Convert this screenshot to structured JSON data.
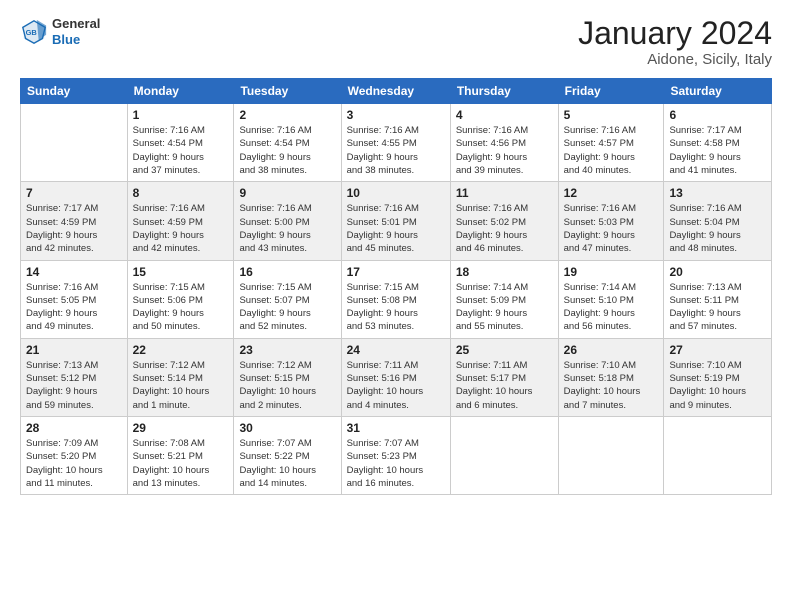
{
  "logo": {
    "general": "General",
    "blue": "Blue"
  },
  "title": "January 2024",
  "subtitle": "Aidone, Sicily, Italy",
  "weekdays": [
    "Sunday",
    "Monday",
    "Tuesday",
    "Wednesday",
    "Thursday",
    "Friday",
    "Saturday"
  ],
  "rows": [
    [
      {
        "day": "",
        "info": ""
      },
      {
        "day": "1",
        "info": "Sunrise: 7:16 AM\nSunset: 4:54 PM\nDaylight: 9 hours\nand 37 minutes."
      },
      {
        "day": "2",
        "info": "Sunrise: 7:16 AM\nSunset: 4:54 PM\nDaylight: 9 hours\nand 38 minutes."
      },
      {
        "day": "3",
        "info": "Sunrise: 7:16 AM\nSunset: 4:55 PM\nDaylight: 9 hours\nand 38 minutes."
      },
      {
        "day": "4",
        "info": "Sunrise: 7:16 AM\nSunset: 4:56 PM\nDaylight: 9 hours\nand 39 minutes."
      },
      {
        "day": "5",
        "info": "Sunrise: 7:16 AM\nSunset: 4:57 PM\nDaylight: 9 hours\nand 40 minutes."
      },
      {
        "day": "6",
        "info": "Sunrise: 7:17 AM\nSunset: 4:58 PM\nDaylight: 9 hours\nand 41 minutes."
      }
    ],
    [
      {
        "day": "7",
        "info": "Sunrise: 7:17 AM\nSunset: 4:59 PM\nDaylight: 9 hours\nand 42 minutes."
      },
      {
        "day": "8",
        "info": "Sunrise: 7:16 AM\nSunset: 4:59 PM\nDaylight: 9 hours\nand 42 minutes."
      },
      {
        "day": "9",
        "info": "Sunrise: 7:16 AM\nSunset: 5:00 PM\nDaylight: 9 hours\nand 43 minutes."
      },
      {
        "day": "10",
        "info": "Sunrise: 7:16 AM\nSunset: 5:01 PM\nDaylight: 9 hours\nand 45 minutes."
      },
      {
        "day": "11",
        "info": "Sunrise: 7:16 AM\nSunset: 5:02 PM\nDaylight: 9 hours\nand 46 minutes."
      },
      {
        "day": "12",
        "info": "Sunrise: 7:16 AM\nSunset: 5:03 PM\nDaylight: 9 hours\nand 47 minutes."
      },
      {
        "day": "13",
        "info": "Sunrise: 7:16 AM\nSunset: 5:04 PM\nDaylight: 9 hours\nand 48 minutes."
      }
    ],
    [
      {
        "day": "14",
        "info": "Sunrise: 7:16 AM\nSunset: 5:05 PM\nDaylight: 9 hours\nand 49 minutes."
      },
      {
        "day": "15",
        "info": "Sunrise: 7:15 AM\nSunset: 5:06 PM\nDaylight: 9 hours\nand 50 minutes."
      },
      {
        "day": "16",
        "info": "Sunrise: 7:15 AM\nSunset: 5:07 PM\nDaylight: 9 hours\nand 52 minutes."
      },
      {
        "day": "17",
        "info": "Sunrise: 7:15 AM\nSunset: 5:08 PM\nDaylight: 9 hours\nand 53 minutes."
      },
      {
        "day": "18",
        "info": "Sunrise: 7:14 AM\nSunset: 5:09 PM\nDaylight: 9 hours\nand 55 minutes."
      },
      {
        "day": "19",
        "info": "Sunrise: 7:14 AM\nSunset: 5:10 PM\nDaylight: 9 hours\nand 56 minutes."
      },
      {
        "day": "20",
        "info": "Sunrise: 7:13 AM\nSunset: 5:11 PM\nDaylight: 9 hours\nand 57 minutes."
      }
    ],
    [
      {
        "day": "21",
        "info": "Sunrise: 7:13 AM\nSunset: 5:12 PM\nDaylight: 9 hours\nand 59 minutes."
      },
      {
        "day": "22",
        "info": "Sunrise: 7:12 AM\nSunset: 5:14 PM\nDaylight: 10 hours\nand 1 minute."
      },
      {
        "day": "23",
        "info": "Sunrise: 7:12 AM\nSunset: 5:15 PM\nDaylight: 10 hours\nand 2 minutes."
      },
      {
        "day": "24",
        "info": "Sunrise: 7:11 AM\nSunset: 5:16 PM\nDaylight: 10 hours\nand 4 minutes."
      },
      {
        "day": "25",
        "info": "Sunrise: 7:11 AM\nSunset: 5:17 PM\nDaylight: 10 hours\nand 6 minutes."
      },
      {
        "day": "26",
        "info": "Sunrise: 7:10 AM\nSunset: 5:18 PM\nDaylight: 10 hours\nand 7 minutes."
      },
      {
        "day": "27",
        "info": "Sunrise: 7:10 AM\nSunset: 5:19 PM\nDaylight: 10 hours\nand 9 minutes."
      }
    ],
    [
      {
        "day": "28",
        "info": "Sunrise: 7:09 AM\nSunset: 5:20 PM\nDaylight: 10 hours\nand 11 minutes."
      },
      {
        "day": "29",
        "info": "Sunrise: 7:08 AM\nSunset: 5:21 PM\nDaylight: 10 hours\nand 13 minutes."
      },
      {
        "day": "30",
        "info": "Sunrise: 7:07 AM\nSunset: 5:22 PM\nDaylight: 10 hours\nand 14 minutes."
      },
      {
        "day": "31",
        "info": "Sunrise: 7:07 AM\nSunset: 5:23 PM\nDaylight: 10 hours\nand 16 minutes."
      },
      {
        "day": "",
        "info": ""
      },
      {
        "day": "",
        "info": ""
      },
      {
        "day": "",
        "info": ""
      }
    ]
  ]
}
